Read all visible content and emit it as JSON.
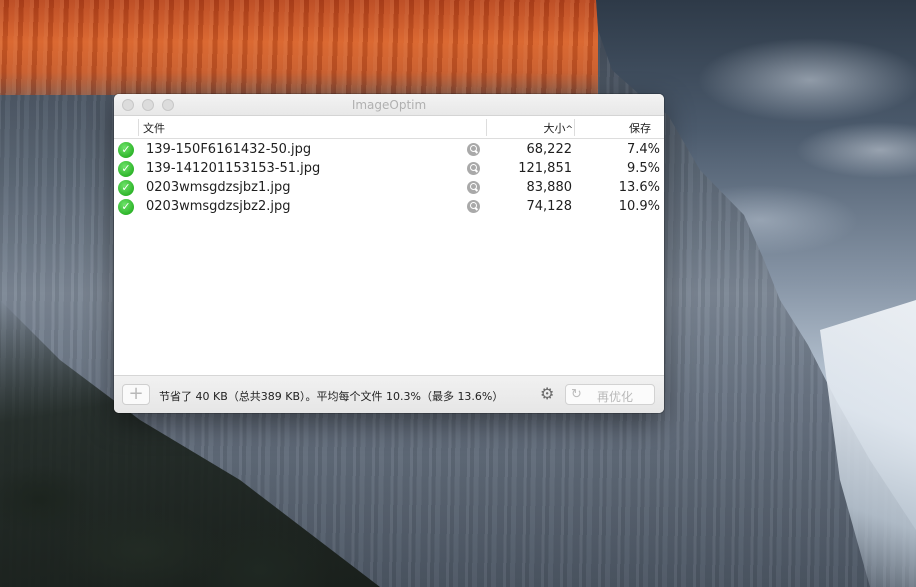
{
  "window": {
    "title": "ImageOptim"
  },
  "columns": {
    "file": "文件",
    "size": "大小",
    "sort_indicator": "^",
    "saved": "保存"
  },
  "files": [
    {
      "name": "139-150F6161432-50.jpg",
      "size": "68,222",
      "saved": "7.4%"
    },
    {
      "name": "139-141201153153-51.jpg",
      "size": "121,851",
      "saved": "9.5%"
    },
    {
      "name": "0203wmsgdzsjbz1.jpg",
      "size": "83,880",
      "saved": "13.6%"
    },
    {
      "name": "0203wmsgdzsjbz2.jpg",
      "size": "74,128",
      "saved": "10.9%"
    }
  ],
  "footer": {
    "add_symbol": "+",
    "status": "节省了 40 KB（总共389 KB）。平均每个文件 10.3%（最多 13.6%）",
    "gear_symbol": "⚙",
    "reoptimize_symbol": "↻",
    "reoptimize_label": "再优化"
  },
  "icons": {
    "status": "check-icon",
    "preview": "magnify-icon"
  },
  "colors": {
    "success": "#2fb52b",
    "title_text": "#b0b0b0"
  }
}
